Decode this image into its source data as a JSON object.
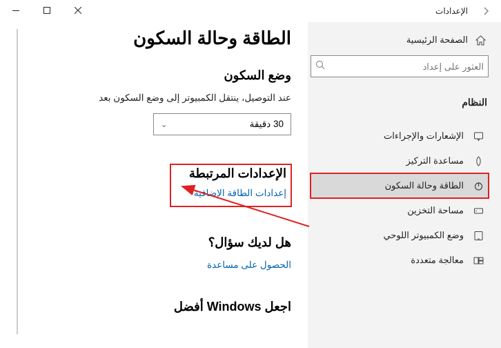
{
  "window": {
    "title": "الإعدادات"
  },
  "sidebar": {
    "home": "الصفحة الرئيسية",
    "search_placeholder": "العثور على إعداد",
    "section": "النظام",
    "items": [
      {
        "label": "الإشعارات والإجراءات",
        "icon": "notify"
      },
      {
        "label": "مساعدة التركيز",
        "icon": "focus"
      },
      {
        "label": "الطاقة وحالة السكون",
        "icon": "power"
      },
      {
        "label": "مساحة التخزين",
        "icon": "storage"
      },
      {
        "label": "وضع الكمبيوتر اللوحي",
        "icon": "tablet"
      },
      {
        "label": "معالجة متعددة",
        "icon": "multitask"
      }
    ]
  },
  "content": {
    "page_title": "الطاقة وحالة السكون",
    "section1_title": "وضع السكون",
    "section1_caption": "عند التوصيل، ينتقل الكمبيوتر إلى وضع السكون بعد",
    "sleep_value": "30 دقيقة",
    "related_title": "الإعدادات المرتبطة",
    "related_link": "إعدادات الطاقة الإضافية",
    "question_title": "هل لديك سؤال؟",
    "help_link": "الحصول على مساعدة",
    "footer_title": "اجعل Windows أفضل"
  }
}
